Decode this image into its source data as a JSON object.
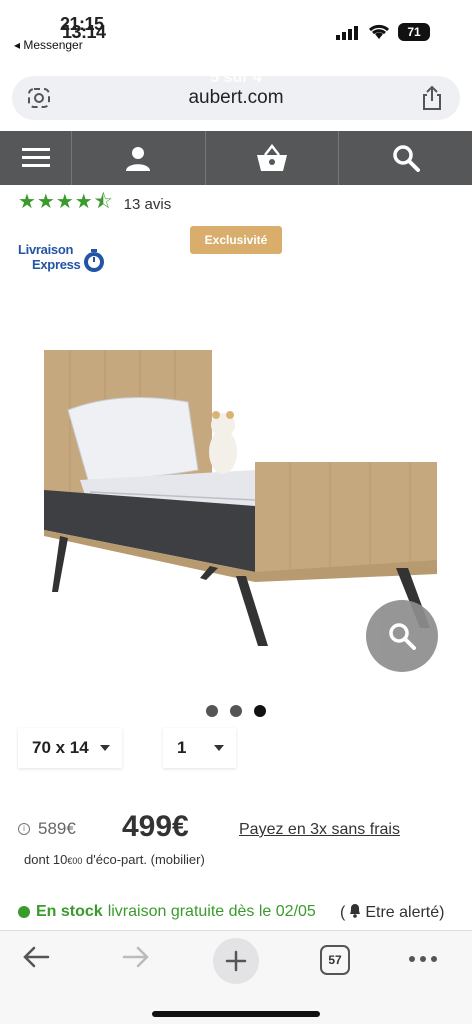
{
  "status_bar": {
    "time_front": "21:15",
    "time_back": "13:14",
    "back_app": "◂ Messenger",
    "battery": "71"
  },
  "browser": {
    "url": "aubert.com",
    "ghost_title": "5 sur 4",
    "tab_count": "57"
  },
  "site_nav": {
    "items": [
      "menu-icon",
      "account-icon",
      "basket-icon",
      "search-icon"
    ]
  },
  "product": {
    "stars_display": "★★★★⯪",
    "rating": 4.5,
    "reviews": "13 avis",
    "express_line1": "Livraison",
    "express_line2": "Express",
    "badge": "Exclusivité",
    "carousel": {
      "count": 3,
      "active": 3
    },
    "size_value": "70 x 14",
    "qty_value": "1",
    "old_price": "589€",
    "price": "499€",
    "installments": "Payez en 3x sans frais",
    "eco_prefix": "dont 10",
    "eco_currency": "€00",
    "eco_suffix": " d'éco-part. (mobilier)",
    "stock_label": "En stock",
    "stock_delivery": "livraison gratuite dès le 02/05",
    "alert_label": "Etre alerté)",
    "alert_prefix": "("
  },
  "colors": {
    "nav_bg": "#555758",
    "accent_green": "#3a9b2c",
    "badge_gold": "#d9ae6c",
    "express_blue": "#2255a6"
  }
}
